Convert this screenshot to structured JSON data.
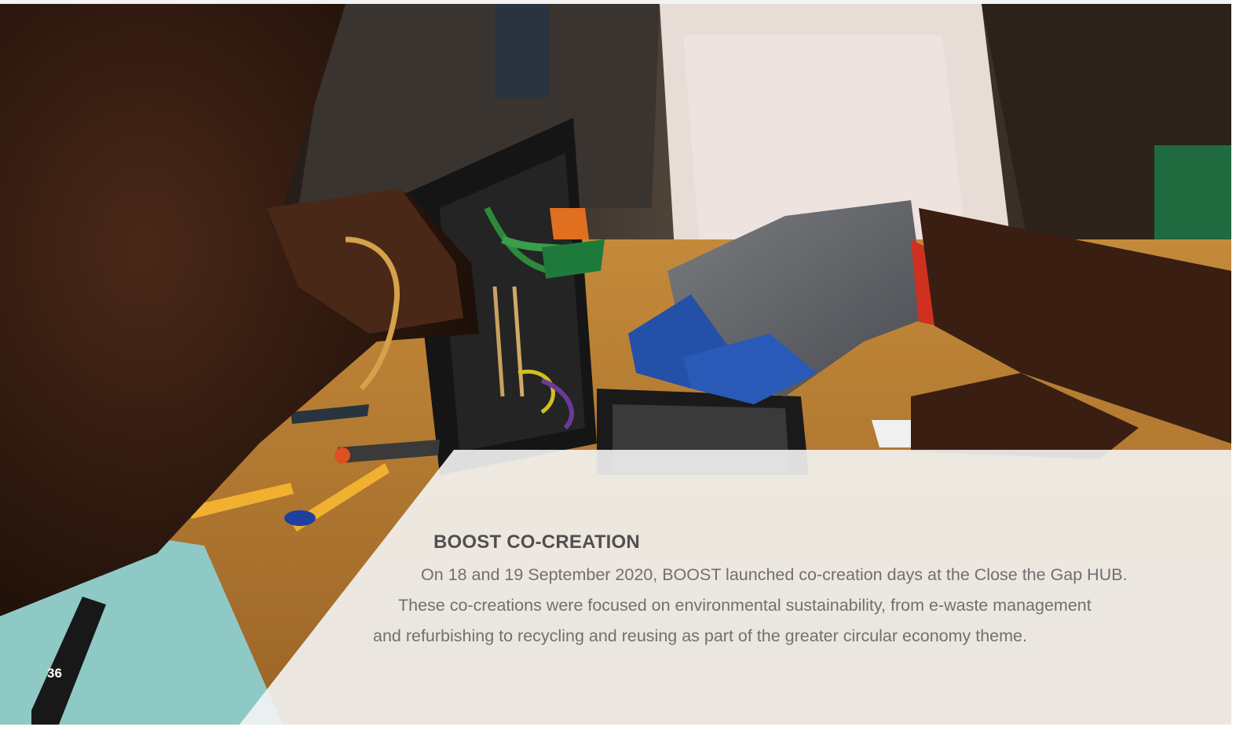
{
  "page": {
    "number": "36",
    "heading": "BOOST CO-CREATION",
    "body_lines": [
      "On  18 and 19 September 2020, BOOST launched co-creation days at the Close the Gap HUB.",
      "These co-creations were focused on environmental sustainability, from e-waste management",
      "and refurbishing to recycling and reusing as part of the greater circular economy theme."
    ]
  },
  "colors": {
    "heading": "#505050",
    "body_text": "#707070",
    "panel": "#f4f4f4",
    "page_number": "#ffffff"
  }
}
